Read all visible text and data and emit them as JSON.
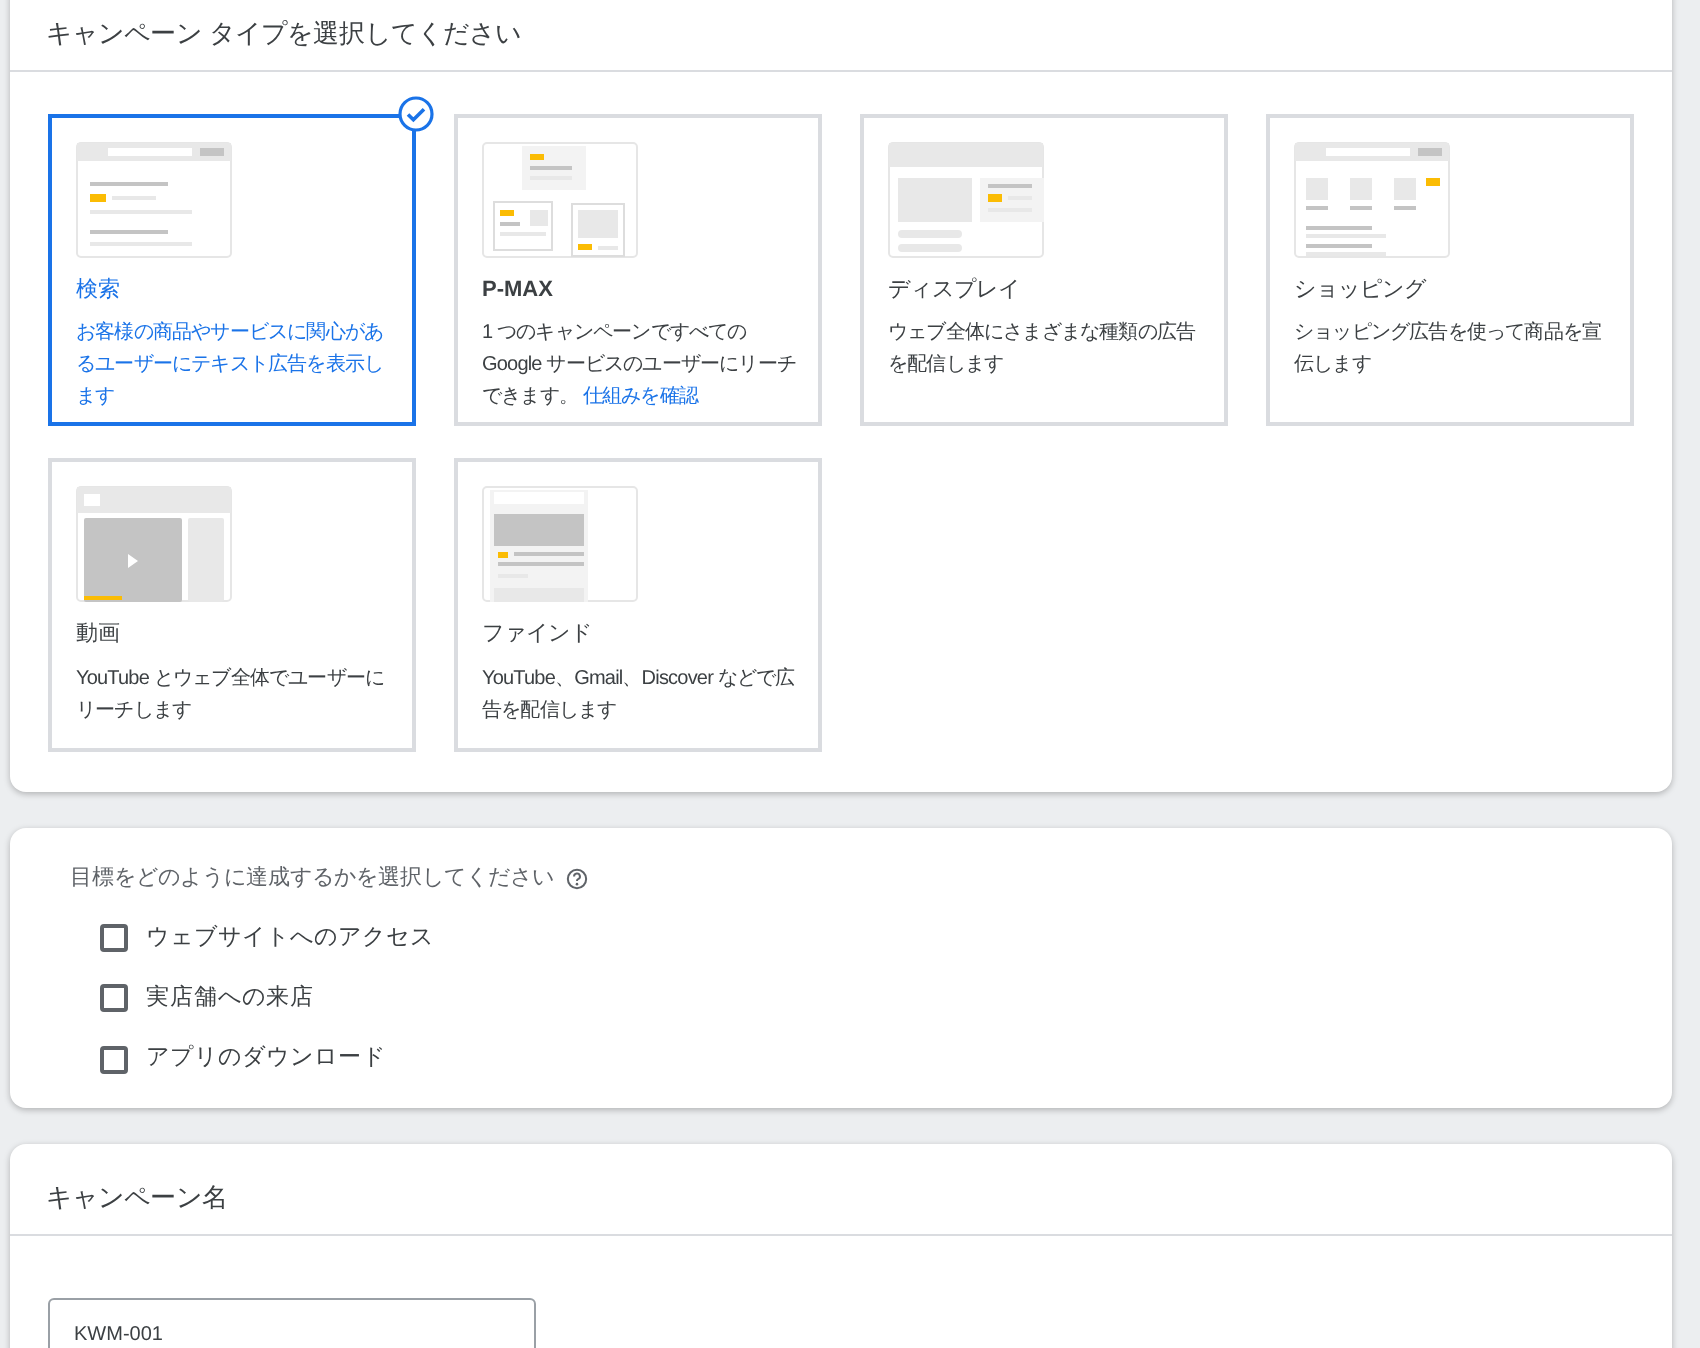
{
  "campaign_type_section": {
    "title": "キャンペーン タイプを選択してください",
    "types": [
      {
        "kind": "search",
        "title": "検索",
        "description": "お客様の商品やサービスに関心があるユーザーにテキスト広告を表示します",
        "selected": true
      },
      {
        "kind": "pmax",
        "title": "P-MAX",
        "description": "1 つのキャンペーンですべての Google サービスのユーザーにリーチできます。",
        "link": "仕組みを確認",
        "selected": false
      },
      {
        "kind": "display",
        "title": "ディスプレイ",
        "description": "ウェブ全体にさまざまな種類の広告を配信します",
        "selected": false
      },
      {
        "kind": "shopping",
        "title": "ショッピング",
        "description": "ショッピング広告を使って商品を宣伝します",
        "selected": false
      },
      {
        "kind": "video",
        "title": "動画",
        "description": "YouTube とウェブ全体でユーザーにリーチします",
        "selected": false
      },
      {
        "kind": "discovery",
        "title": "ファインド",
        "description": "YouTube、Gmail、Discover などで広告を配信します",
        "selected": false
      }
    ]
  },
  "goal_section": {
    "label": "目標をどのように達成するかを選択してください",
    "options": [
      {
        "label": "ウェブサイトへのアクセス",
        "checked": false
      },
      {
        "label": "実店舗への来店",
        "checked": false
      },
      {
        "label": "アプリのダウンロード",
        "checked": false
      }
    ]
  },
  "campaign_name_section": {
    "title": "キャンペーン名",
    "value": "KWM-001"
  }
}
